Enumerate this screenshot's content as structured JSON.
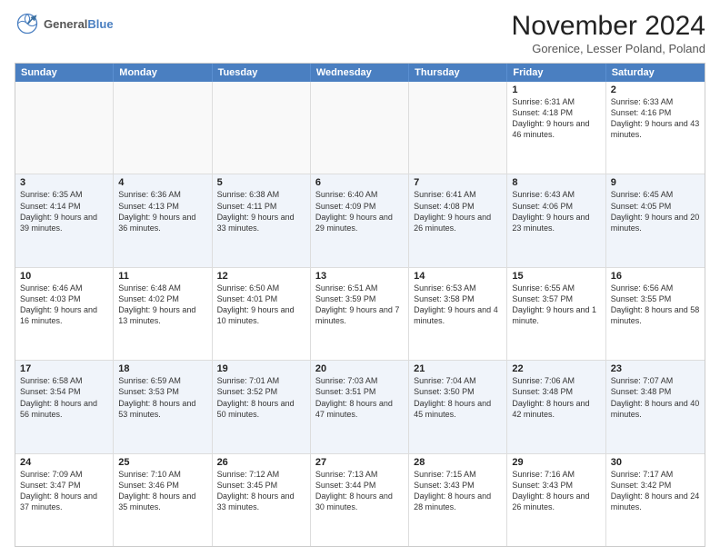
{
  "logo": {
    "line1": "General",
    "line2": "Blue"
  },
  "title": "November 2024",
  "location": "Gorenice, Lesser Poland, Poland",
  "weekdays": [
    "Sunday",
    "Monday",
    "Tuesday",
    "Wednesday",
    "Thursday",
    "Friday",
    "Saturday"
  ],
  "rows": [
    [
      {
        "day": "",
        "info": "",
        "empty": true
      },
      {
        "day": "",
        "info": "",
        "empty": true
      },
      {
        "day": "",
        "info": "",
        "empty": true
      },
      {
        "day": "",
        "info": "",
        "empty": true
      },
      {
        "day": "",
        "info": "",
        "empty": true
      },
      {
        "day": "1",
        "info": "Sunrise: 6:31 AM\nSunset: 4:18 PM\nDaylight: 9 hours and 46 minutes.",
        "empty": false
      },
      {
        "day": "2",
        "info": "Sunrise: 6:33 AM\nSunset: 4:16 PM\nDaylight: 9 hours and 43 minutes.",
        "empty": false
      }
    ],
    [
      {
        "day": "3",
        "info": "Sunrise: 6:35 AM\nSunset: 4:14 PM\nDaylight: 9 hours and 39 minutes.",
        "empty": false
      },
      {
        "day": "4",
        "info": "Sunrise: 6:36 AM\nSunset: 4:13 PM\nDaylight: 9 hours and 36 minutes.",
        "empty": false
      },
      {
        "day": "5",
        "info": "Sunrise: 6:38 AM\nSunset: 4:11 PM\nDaylight: 9 hours and 33 minutes.",
        "empty": false
      },
      {
        "day": "6",
        "info": "Sunrise: 6:40 AM\nSunset: 4:09 PM\nDaylight: 9 hours and 29 minutes.",
        "empty": false
      },
      {
        "day": "7",
        "info": "Sunrise: 6:41 AM\nSunset: 4:08 PM\nDaylight: 9 hours and 26 minutes.",
        "empty": false
      },
      {
        "day": "8",
        "info": "Sunrise: 6:43 AM\nSunset: 4:06 PM\nDaylight: 9 hours and 23 minutes.",
        "empty": false
      },
      {
        "day": "9",
        "info": "Sunrise: 6:45 AM\nSunset: 4:05 PM\nDaylight: 9 hours and 20 minutes.",
        "empty": false
      }
    ],
    [
      {
        "day": "10",
        "info": "Sunrise: 6:46 AM\nSunset: 4:03 PM\nDaylight: 9 hours and 16 minutes.",
        "empty": false
      },
      {
        "day": "11",
        "info": "Sunrise: 6:48 AM\nSunset: 4:02 PM\nDaylight: 9 hours and 13 minutes.",
        "empty": false
      },
      {
        "day": "12",
        "info": "Sunrise: 6:50 AM\nSunset: 4:01 PM\nDaylight: 9 hours and 10 minutes.",
        "empty": false
      },
      {
        "day": "13",
        "info": "Sunrise: 6:51 AM\nSunset: 3:59 PM\nDaylight: 9 hours and 7 minutes.",
        "empty": false
      },
      {
        "day": "14",
        "info": "Sunrise: 6:53 AM\nSunset: 3:58 PM\nDaylight: 9 hours and 4 minutes.",
        "empty": false
      },
      {
        "day": "15",
        "info": "Sunrise: 6:55 AM\nSunset: 3:57 PM\nDaylight: 9 hours and 1 minute.",
        "empty": false
      },
      {
        "day": "16",
        "info": "Sunrise: 6:56 AM\nSunset: 3:55 PM\nDaylight: 8 hours and 58 minutes.",
        "empty": false
      }
    ],
    [
      {
        "day": "17",
        "info": "Sunrise: 6:58 AM\nSunset: 3:54 PM\nDaylight: 8 hours and 56 minutes.",
        "empty": false
      },
      {
        "day": "18",
        "info": "Sunrise: 6:59 AM\nSunset: 3:53 PM\nDaylight: 8 hours and 53 minutes.",
        "empty": false
      },
      {
        "day": "19",
        "info": "Sunrise: 7:01 AM\nSunset: 3:52 PM\nDaylight: 8 hours and 50 minutes.",
        "empty": false
      },
      {
        "day": "20",
        "info": "Sunrise: 7:03 AM\nSunset: 3:51 PM\nDaylight: 8 hours and 47 minutes.",
        "empty": false
      },
      {
        "day": "21",
        "info": "Sunrise: 7:04 AM\nSunset: 3:50 PM\nDaylight: 8 hours and 45 minutes.",
        "empty": false
      },
      {
        "day": "22",
        "info": "Sunrise: 7:06 AM\nSunset: 3:48 PM\nDaylight: 8 hours and 42 minutes.",
        "empty": false
      },
      {
        "day": "23",
        "info": "Sunrise: 7:07 AM\nSunset: 3:48 PM\nDaylight: 8 hours and 40 minutes.",
        "empty": false
      }
    ],
    [
      {
        "day": "24",
        "info": "Sunrise: 7:09 AM\nSunset: 3:47 PM\nDaylight: 8 hours and 37 minutes.",
        "empty": false
      },
      {
        "day": "25",
        "info": "Sunrise: 7:10 AM\nSunset: 3:46 PM\nDaylight: 8 hours and 35 minutes.",
        "empty": false
      },
      {
        "day": "26",
        "info": "Sunrise: 7:12 AM\nSunset: 3:45 PM\nDaylight: 8 hours and 33 minutes.",
        "empty": false
      },
      {
        "day": "27",
        "info": "Sunrise: 7:13 AM\nSunset: 3:44 PM\nDaylight: 8 hours and 30 minutes.",
        "empty": false
      },
      {
        "day": "28",
        "info": "Sunrise: 7:15 AM\nSunset: 3:43 PM\nDaylight: 8 hours and 28 minutes.",
        "empty": false
      },
      {
        "day": "29",
        "info": "Sunrise: 7:16 AM\nSunset: 3:43 PM\nDaylight: 8 hours and 26 minutes.",
        "empty": false
      },
      {
        "day": "30",
        "info": "Sunrise: 7:17 AM\nSunset: 3:42 PM\nDaylight: 8 hours and 24 minutes.",
        "empty": false
      }
    ]
  ]
}
